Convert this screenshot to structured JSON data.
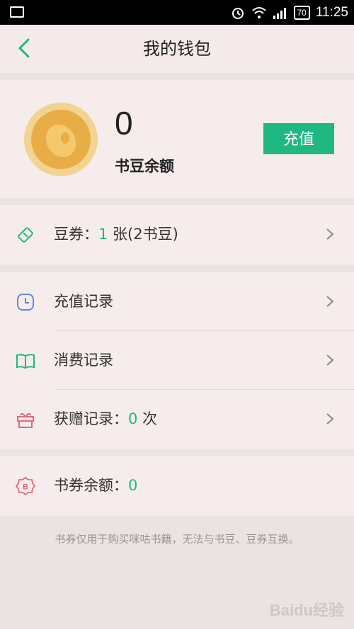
{
  "status_bar": {
    "time": "11:25",
    "battery": "70"
  },
  "header": {
    "title": "我的钱包"
  },
  "balance": {
    "amount": "0",
    "label": "书豆余额",
    "recharge_label": "充值"
  },
  "coupon": {
    "prefix": "豆券：",
    "count": "1",
    "suffix": " 张(2书豆)"
  },
  "records": [
    {
      "label": "充值记录"
    },
    {
      "label": "消费记录"
    },
    {
      "label_prefix": "获赠记录：",
      "count": "0",
      "label_suffix": " 次"
    }
  ],
  "book_coupon": {
    "prefix": "书券余额：",
    "amount": "0"
  },
  "footnote": "书券仅用于购买咪咕书籍，无法与书豆、豆券互换。",
  "watermark": "Baidu经验",
  "colors": {
    "accent": "#1fb882",
    "background": "#ebe3e3",
    "card": "#f6ecec"
  },
  "icons": {
    "back": "chevron-left-icon",
    "coupon": "ticket-icon",
    "recharge_record": "clock-icon",
    "consume_record": "book-icon",
    "gift_record": "gift-icon",
    "book_coupon": "badge-icon",
    "row_chevron": "chevron-right-icon"
  }
}
